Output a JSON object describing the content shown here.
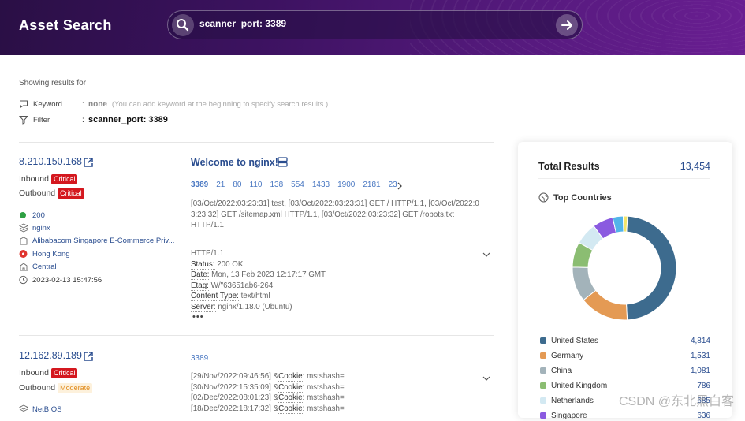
{
  "header": {
    "brand": "Asset Search",
    "query": "scanner_port: 3389"
  },
  "query_info": {
    "showing": "Showing results for",
    "keyword_label": "Keyword",
    "keyword_value": "none",
    "keyword_hint": "(You can add keyword at the beginning to specify search results.)",
    "filter_label": "Filter",
    "filter_value": "scanner_port: 3389"
  },
  "results": [
    {
      "ip": "8.210.150.168",
      "inbound": "Inbound",
      "inbound_level": "Critical",
      "outbound": "Outbound",
      "outbound_level": "Critical",
      "status_code": "200",
      "server": "nginx",
      "org": "Alibabacom Singapore E-Commerce Priv...",
      "location": "Hong Kong",
      "region": "Central",
      "time": "2023-02-13 15:47:56",
      "title": "Welcome to nginx!",
      "ports": [
        "3389",
        "21",
        "80",
        "110",
        "138",
        "554",
        "1433",
        "1900",
        "2181",
        "23"
      ],
      "log": [
        "[03/Oct/2022:03:23:31] test, [03/Oct/2022:03:23:31] GET / HTTP/1.1, [03/Oct/2022:0",
        "3:23:32] GET /sitemap.xml HTTP/1.1, [03/Oct/2022:03:23:32] GET /robots.txt",
        "HTTP/1.1"
      ],
      "http": {
        "line": "HTTP/1.1",
        "status_k": "Status:",
        "status_v": "200 OK",
        "date_k": "Date:",
        "date_v": "Mon, 13 Feb 2023 12:17:17 GMT",
        "etag_k": "Etag:",
        "etag_v": "W/\"63651ab6-264",
        "ctype_k": "Content Type:",
        "ctype_v": "text/html",
        "server_k": "Server:",
        "server_v": "nginx/1.18.0 (Ubuntu)",
        "more": "•••"
      }
    },
    {
      "ip": "12.162.89.189",
      "inbound": "Inbound",
      "inbound_level": "Critical",
      "outbound": "Outbound",
      "outbound_level": "Moderate",
      "service": "NetBIOS",
      "ports": [
        "3389"
      ],
      "log": [
        {
          "t": "[29/Nov/2022:09:46:56] &",
          "k": "Cookie:",
          "v": "mstshash="
        },
        {
          "t": "[30/Nov/2022:15:35:09] &",
          "k": "Cookie:",
          "v": "mstshash="
        },
        {
          "t": "[02/Dec/2022:08:01:23] &",
          "k": "Cookie:",
          "v": "mstshash="
        },
        {
          "t": "[18/Dec/2022:18:17:32] &",
          "k": "Cookie:",
          "v": "mstshash="
        }
      ]
    }
  ],
  "summary": {
    "title": "Total Results",
    "total": "13,454",
    "top_countries": "Top Countries",
    "countries": [
      {
        "name": "United States",
        "count": "4,814",
        "value": 4814,
        "color": "#3d6b8e"
      },
      {
        "name": "Germany",
        "count": "1,531",
        "value": 1531,
        "color": "#e49a54"
      },
      {
        "name": "China",
        "count": "1,081",
        "value": 1081,
        "color": "#a3b3ba"
      },
      {
        "name": "United Kingdom",
        "count": "786",
        "value": 786,
        "color": "#8bbd72"
      },
      {
        "name": "Netherlands",
        "count": "685",
        "value": 685,
        "color": "#d3e9f2"
      },
      {
        "name": "Singapore",
        "count": "636",
        "value": 636,
        "color": "#8a5ae0"
      }
    ],
    "extra_slices": [
      {
        "value": 330,
        "color": "#52b4e9"
      },
      {
        "value": 130,
        "color": "#f3e56a"
      }
    ]
  },
  "watermark": "CSDN @东北黑白客"
}
